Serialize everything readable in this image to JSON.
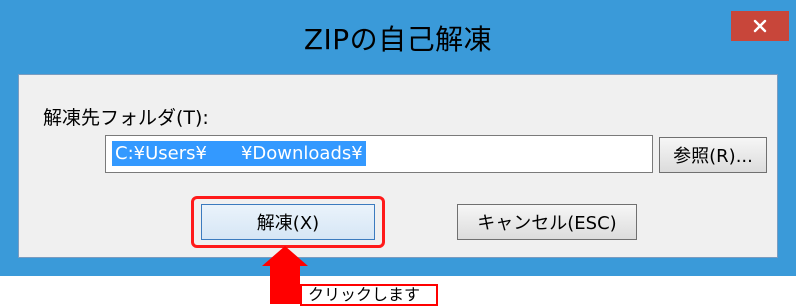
{
  "window": {
    "title": "ZIPの自己解凍",
    "close_icon": "close-icon"
  },
  "dialog": {
    "folder_label": "解凍先フォルダ(T):",
    "path_part1": "C:¥Users¥",
    "path_part2": "¥Downloads¥",
    "browse_label": "参照(R)...",
    "extract_label": "解凍(X)",
    "cancel_label": "キャンセル(ESC)"
  },
  "annotation": {
    "callout_text": "クリックします",
    "highlight_color": "#ff1a1a",
    "arrow_color": "#ff0000"
  },
  "colors": {
    "frame": "#3a9ad9",
    "close_button": "#c8463a",
    "selection": "#3399ff"
  }
}
